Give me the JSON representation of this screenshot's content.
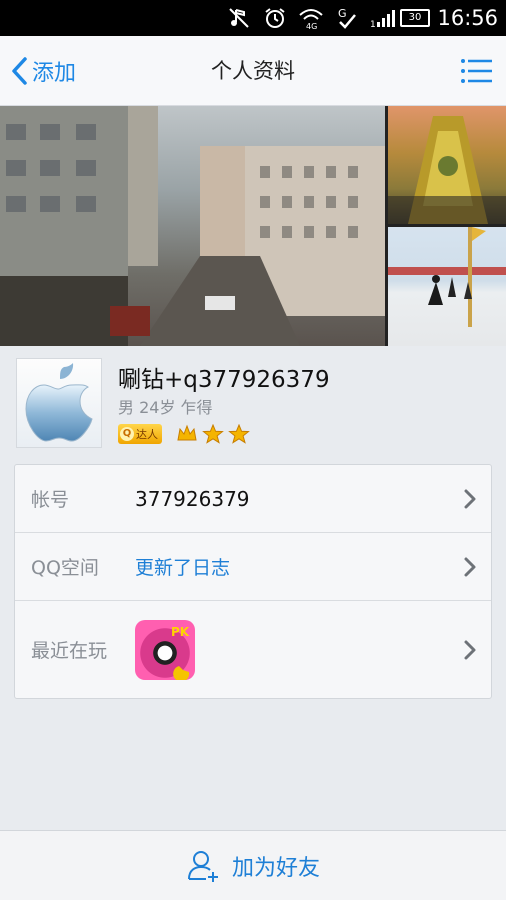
{
  "status_bar": {
    "time": "16:56",
    "battery": "30",
    "icons": [
      "mute-icon",
      "alarm-icon",
      "wifi-4g-icon",
      "signal-g-icon",
      "signal-bars-icon",
      "battery-icon"
    ]
  },
  "title_bar": {
    "back_label": "添加",
    "title": "个人资料",
    "menu_icon": "list-menu-icon"
  },
  "profile": {
    "nickname": "唰钻+q377926379",
    "meta": "男 24岁 乍得",
    "daren_badge": "达人",
    "daren_q": "Q",
    "stars_count": 3
  },
  "info_rows": [
    {
      "label": "帐号",
      "value": "377926379"
    },
    {
      "label": "QQ空间",
      "value": "更新了日志"
    },
    {
      "label": "最近在玩",
      "value": ""
    }
  ],
  "bottom": {
    "add_friend_label": "加为好友"
  },
  "colors": {
    "accent": "#1e7fd6",
    "status_bar": "#000000",
    "background": "#e8ebef"
  }
}
